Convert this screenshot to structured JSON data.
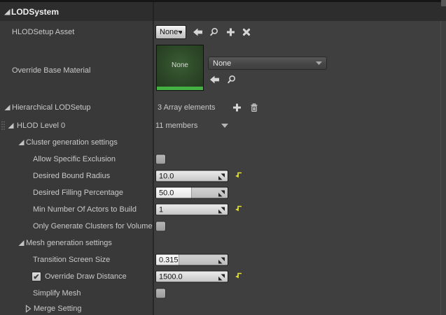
{
  "colors": {
    "accent_yellow": "#e4e434",
    "thumbnail_green": "#2c4727",
    "thumbnail_strip_green": "#43b243",
    "header_bg": "#2d2d2d",
    "left_column_bg": "#393939",
    "right_column_bg": "#3f3f3f"
  },
  "icons": {
    "use_selected": "arrow-left",
    "browse": "magnifier",
    "add": "plus",
    "clear": "x-cross",
    "delete": "trash-can",
    "drag": "dot-grip",
    "value_drag": "diagonal-arrows",
    "reset": "yellow-undo-arrow"
  },
  "header": {
    "title": "LODSystem"
  },
  "rows": {
    "hlod_setup_asset": {
      "label": "HLODSetup Asset",
      "dropdown_value": "None"
    },
    "override_base_material": {
      "label": "Override Base Material",
      "thumbnail_label": "None",
      "combo_value": "None"
    },
    "hierarchical_lod_setup": {
      "label": "Hierarchical LODSetup",
      "summary": "3 Array elements"
    },
    "hlod_level_0": {
      "label": "HLOD Level 0",
      "summary": "11 members"
    },
    "cluster_generation_settings": {
      "label": "Cluster generation settings"
    },
    "allow_specific_exclusion": {
      "label": "Allow Specific Exclusion",
      "checked": false
    },
    "desired_bound_radius": {
      "label": "Desired Bound Radius",
      "value": "10.0",
      "has_reset": true
    },
    "desired_filling_percentage": {
      "label": "Desired Filling Percentage",
      "value": "50.0",
      "fill_style": "width:50%"
    },
    "min_number_of_actors": {
      "label": "Min Number Of Actors to Build",
      "value": "1",
      "has_reset": true
    },
    "only_generate_clusters": {
      "label": "Only Generate Clusters for Volume",
      "checked": false
    },
    "mesh_generation_settings": {
      "label": "Mesh generation settings"
    },
    "transition_screen_size": {
      "label": "Transition Screen Size",
      "value": "0.315",
      "fill_style": "width:32%"
    },
    "override_draw_distance": {
      "label": "Override Draw Distance",
      "checked": true,
      "check_glyph": "✔",
      "value": "1500.0",
      "has_reset": true
    },
    "simplify_mesh": {
      "label": "Simplify Mesh",
      "checked": false
    },
    "merge_setting": {
      "label": "Merge Setting"
    }
  }
}
